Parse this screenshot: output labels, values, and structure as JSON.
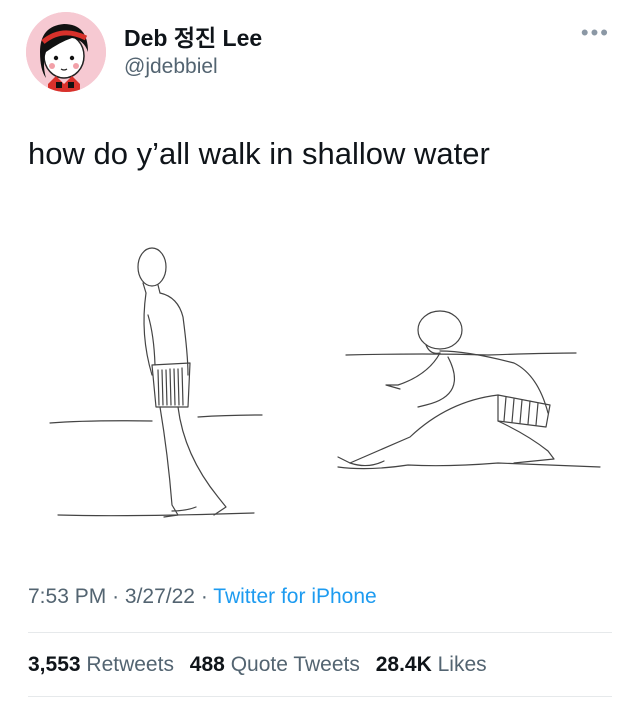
{
  "author": {
    "display_name": "Deb 정진 Lee",
    "handle": "@jdebbiel"
  },
  "tweet": {
    "text": "how do y’all walk in shallow water"
  },
  "meta": {
    "time": "7:53 PM",
    "separator": "·",
    "date": "3/27/22",
    "source": "Twitter for iPhone"
  },
  "stats": {
    "retweets_count": "3,553",
    "retweets_label": "Retweets",
    "quotes_count": "488",
    "quotes_label": "Quote Tweets",
    "likes_count": "28.4K",
    "likes_label": "Likes"
  },
  "icons": {
    "more": "more-options-icon"
  },
  "colors": {
    "link": "#1d9bf0",
    "secondary_text": "#536471",
    "avatar_bg": "#f6c9d2"
  }
}
